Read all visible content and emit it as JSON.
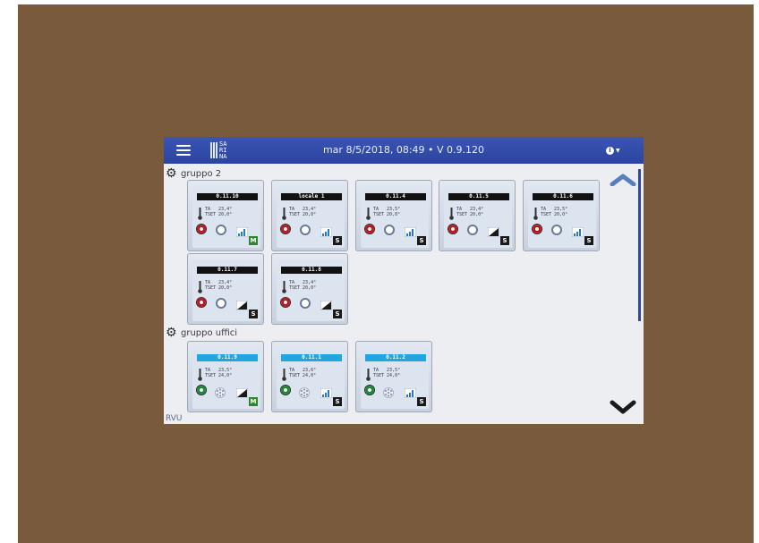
{
  "header": {
    "logo_text": "SA\nRI\nNA",
    "datetime": "mar 8/5/2018, 08:49 • V 0.9.120"
  },
  "groups": [
    {
      "label": "gruppo 2",
      "devices": [
        {
          "name": "0.11.10",
          "ta": "TA   23,4°",
          "tset": "TSET 20,0°",
          "mode": "M",
          "signal": "bars",
          "theme": "dark",
          "power": "red",
          "fan": "ring"
        },
        {
          "name": "locale 1",
          "ta": "TA   23,4°",
          "tset": "TSET 20,0°",
          "mode": "S",
          "signal": "bars",
          "theme": "dark",
          "power": "red",
          "fan": "ring"
        },
        {
          "name": "0.11.4",
          "ta": "TA   23,5°",
          "tset": "TSET 20,0°",
          "mode": "S",
          "signal": "bars",
          "theme": "dark",
          "power": "red",
          "fan": "ring"
        },
        {
          "name": "0.11.5",
          "ta": "TA   23,4°",
          "tset": "TSET 20,0°",
          "mode": "S",
          "signal": "wedge",
          "theme": "dark",
          "power": "red",
          "fan": "ring"
        },
        {
          "name": "0.11.6",
          "ta": "TA   23,5°",
          "tset": "TSET 20,0°",
          "mode": "S",
          "signal": "bars",
          "theme": "dark",
          "power": "red",
          "fan": "ring"
        },
        {
          "name": "0.11.7",
          "ta": "TA   23,4°",
          "tset": "TSET 20,0°",
          "mode": "S",
          "signal": "wedge",
          "theme": "dark",
          "power": "red",
          "fan": "ring"
        },
        {
          "name": "0.11.8",
          "ta": "TA   23,4°",
          "tset": "TSET 20,0°",
          "mode": "S",
          "signal": "wedge",
          "theme": "dark",
          "power": "red",
          "fan": "ring"
        }
      ]
    },
    {
      "label": "gruppo uffici",
      "devices": [
        {
          "name": "0.11.9",
          "ta": "TA   23,5°",
          "tset": "TSET 24,0°",
          "mode": "M",
          "signal": "wedge",
          "theme": "blue",
          "power": "green",
          "fan": "fan"
        },
        {
          "name": "0.11.1",
          "ta": "TA   23,6°",
          "tset": "TSET 24,0°",
          "mode": "S",
          "signal": "bars",
          "theme": "blue",
          "power": "green",
          "fan": "fan"
        },
        {
          "name": "0.11.2",
          "ta": "TA   23,5°",
          "tset": "TSET 24,0°",
          "mode": "S",
          "signal": "bars",
          "theme": "blue",
          "power": "green",
          "fan": "fan"
        }
      ]
    }
  ],
  "footer": {
    "label": "RVU"
  },
  "icons": {
    "menu": "hamburger-icon",
    "info": "info-icon",
    "scroll_up": "chevron-up-icon",
    "scroll_down": "chevron-down-icon",
    "group": "gear-icon"
  },
  "colors": {
    "topbar": "#2b44a0",
    "panel_dark_label": "#111111",
    "panel_blue_label": "#22a6e0",
    "power_red": "#c01722",
    "power_green": "#1d8a36",
    "mode_manual": "#2a8a2a"
  }
}
